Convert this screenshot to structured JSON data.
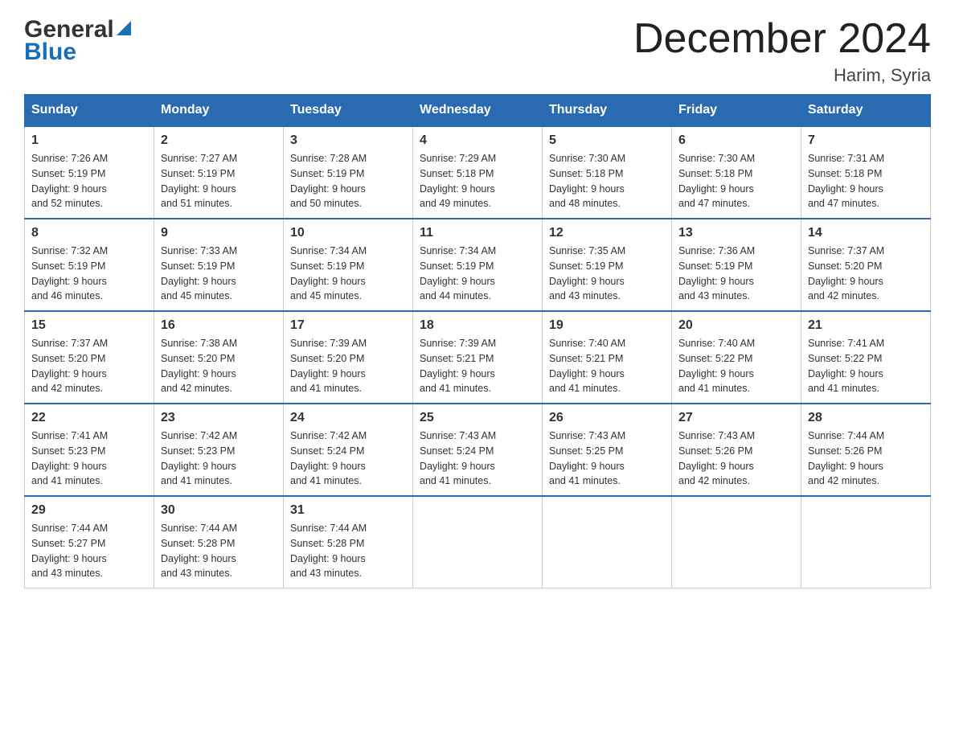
{
  "header": {
    "logo_line1": "General",
    "logo_line2": "Blue",
    "title": "December 2024",
    "subtitle": "Harim, Syria"
  },
  "days_of_week": [
    "Sunday",
    "Monday",
    "Tuesday",
    "Wednesday",
    "Thursday",
    "Friday",
    "Saturday"
  ],
  "weeks": [
    [
      {
        "day": "1",
        "sunrise": "7:26 AM",
        "sunset": "5:19 PM",
        "daylight": "9 hours and 52 minutes."
      },
      {
        "day": "2",
        "sunrise": "7:27 AM",
        "sunset": "5:19 PM",
        "daylight": "9 hours and 51 minutes."
      },
      {
        "day": "3",
        "sunrise": "7:28 AM",
        "sunset": "5:19 PM",
        "daylight": "9 hours and 50 minutes."
      },
      {
        "day": "4",
        "sunrise": "7:29 AM",
        "sunset": "5:18 PM",
        "daylight": "9 hours and 49 minutes."
      },
      {
        "day": "5",
        "sunrise": "7:30 AM",
        "sunset": "5:18 PM",
        "daylight": "9 hours and 48 minutes."
      },
      {
        "day": "6",
        "sunrise": "7:30 AM",
        "sunset": "5:18 PM",
        "daylight": "9 hours and 47 minutes."
      },
      {
        "day": "7",
        "sunrise": "7:31 AM",
        "sunset": "5:18 PM",
        "daylight": "9 hours and 47 minutes."
      }
    ],
    [
      {
        "day": "8",
        "sunrise": "7:32 AM",
        "sunset": "5:19 PM",
        "daylight": "9 hours and 46 minutes."
      },
      {
        "day": "9",
        "sunrise": "7:33 AM",
        "sunset": "5:19 PM",
        "daylight": "9 hours and 45 minutes."
      },
      {
        "day": "10",
        "sunrise": "7:34 AM",
        "sunset": "5:19 PM",
        "daylight": "9 hours and 45 minutes."
      },
      {
        "day": "11",
        "sunrise": "7:34 AM",
        "sunset": "5:19 PM",
        "daylight": "9 hours and 44 minutes."
      },
      {
        "day": "12",
        "sunrise": "7:35 AM",
        "sunset": "5:19 PM",
        "daylight": "9 hours and 43 minutes."
      },
      {
        "day": "13",
        "sunrise": "7:36 AM",
        "sunset": "5:19 PM",
        "daylight": "9 hours and 43 minutes."
      },
      {
        "day": "14",
        "sunrise": "7:37 AM",
        "sunset": "5:20 PM",
        "daylight": "9 hours and 42 minutes."
      }
    ],
    [
      {
        "day": "15",
        "sunrise": "7:37 AM",
        "sunset": "5:20 PM",
        "daylight": "9 hours and 42 minutes."
      },
      {
        "day": "16",
        "sunrise": "7:38 AM",
        "sunset": "5:20 PM",
        "daylight": "9 hours and 42 minutes."
      },
      {
        "day": "17",
        "sunrise": "7:39 AM",
        "sunset": "5:20 PM",
        "daylight": "9 hours and 41 minutes."
      },
      {
        "day": "18",
        "sunrise": "7:39 AM",
        "sunset": "5:21 PM",
        "daylight": "9 hours and 41 minutes."
      },
      {
        "day": "19",
        "sunrise": "7:40 AM",
        "sunset": "5:21 PM",
        "daylight": "9 hours and 41 minutes."
      },
      {
        "day": "20",
        "sunrise": "7:40 AM",
        "sunset": "5:22 PM",
        "daylight": "9 hours and 41 minutes."
      },
      {
        "day": "21",
        "sunrise": "7:41 AM",
        "sunset": "5:22 PM",
        "daylight": "9 hours and 41 minutes."
      }
    ],
    [
      {
        "day": "22",
        "sunrise": "7:41 AM",
        "sunset": "5:23 PM",
        "daylight": "9 hours and 41 minutes."
      },
      {
        "day": "23",
        "sunrise": "7:42 AM",
        "sunset": "5:23 PM",
        "daylight": "9 hours and 41 minutes."
      },
      {
        "day": "24",
        "sunrise": "7:42 AM",
        "sunset": "5:24 PM",
        "daylight": "9 hours and 41 minutes."
      },
      {
        "day": "25",
        "sunrise": "7:43 AM",
        "sunset": "5:24 PM",
        "daylight": "9 hours and 41 minutes."
      },
      {
        "day": "26",
        "sunrise": "7:43 AM",
        "sunset": "5:25 PM",
        "daylight": "9 hours and 41 minutes."
      },
      {
        "day": "27",
        "sunrise": "7:43 AM",
        "sunset": "5:26 PM",
        "daylight": "9 hours and 42 minutes."
      },
      {
        "day": "28",
        "sunrise": "7:44 AM",
        "sunset": "5:26 PM",
        "daylight": "9 hours and 42 minutes."
      }
    ],
    [
      {
        "day": "29",
        "sunrise": "7:44 AM",
        "sunset": "5:27 PM",
        "daylight": "9 hours and 43 minutes."
      },
      {
        "day": "30",
        "sunrise": "7:44 AM",
        "sunset": "5:28 PM",
        "daylight": "9 hours and 43 minutes."
      },
      {
        "day": "31",
        "sunrise": "7:44 AM",
        "sunset": "5:28 PM",
        "daylight": "9 hours and 43 minutes."
      },
      null,
      null,
      null,
      null
    ]
  ],
  "labels": {
    "sunrise": "Sunrise:",
    "sunset": "Sunset:",
    "daylight": "Daylight:"
  }
}
